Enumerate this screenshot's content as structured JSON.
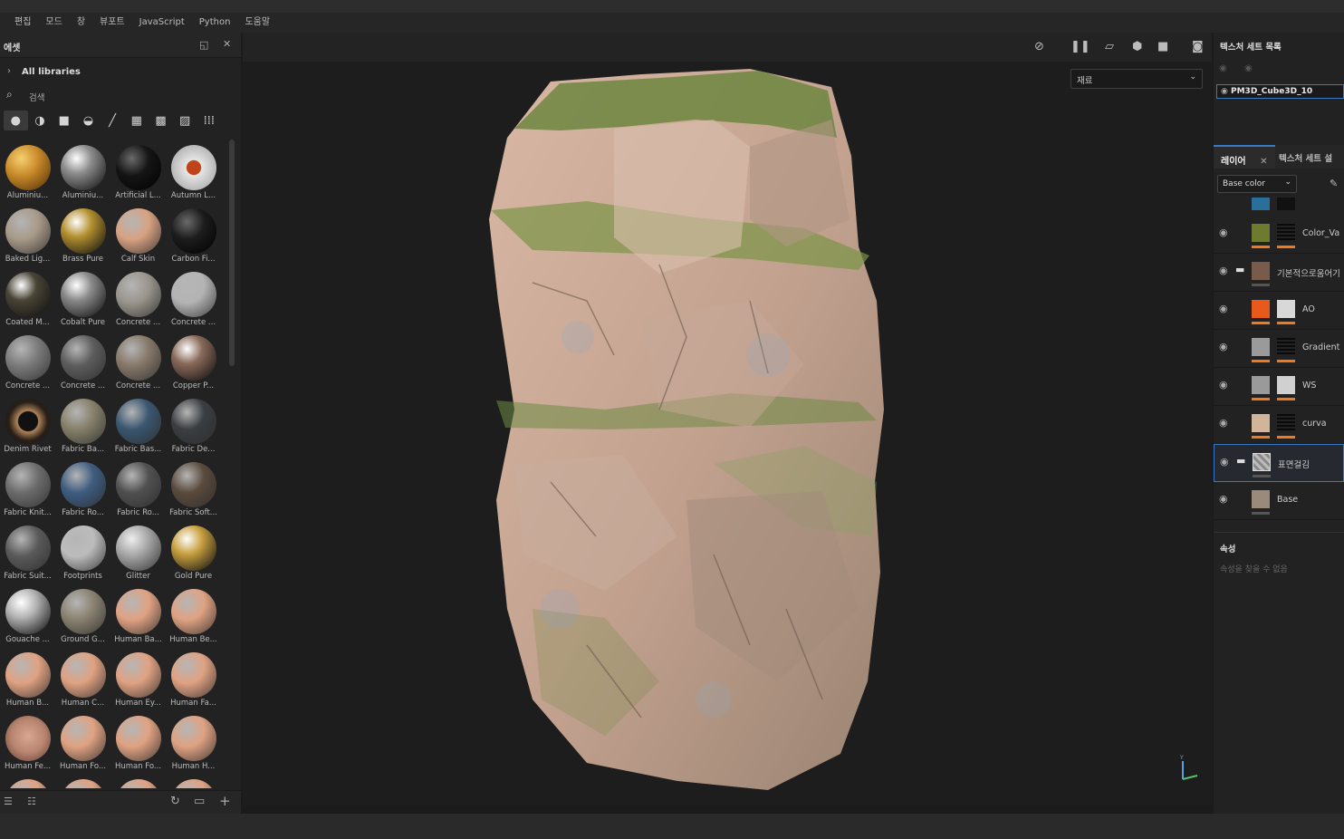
{
  "menu": [
    "편집",
    "모드",
    "창",
    "뷰포트",
    "JavaScript",
    "Python",
    "도움말"
  ],
  "assets": {
    "title": "에셋",
    "library": "All libraries",
    "search_placeholder": "검색",
    "filters": [
      "sphere-icon",
      "half-sphere-icon",
      "square-icon",
      "material-icon",
      "brush-icon",
      "particle-icon",
      "pattern-icon",
      "image-icon",
      "grid-view-icon"
    ],
    "items": [
      {
        "label": "Aluminiu...",
        "color": "#c88a2a",
        "style": "gold-dots"
      },
      {
        "label": "Aluminiu...",
        "color": "#8c8c8c",
        "style": "metal"
      },
      {
        "label": "Artificial L...",
        "color": "#151515",
        "style": "dark"
      },
      {
        "label": "Autumn L...",
        "color": "#d8d8d8",
        "style": "leaf"
      },
      {
        "label": "Baked Lig...",
        "color": "#a89a88",
        "style": "matte"
      },
      {
        "label": "Brass Pure",
        "color": "#b49030",
        "style": "metal"
      },
      {
        "label": "Calf Skin",
        "color": "#d8a282",
        "style": "matte"
      },
      {
        "label": "Carbon Fi...",
        "color": "#1c1c1c",
        "style": "carbon"
      },
      {
        "label": "Coated M...",
        "color": "#4a4436",
        "style": "metal"
      },
      {
        "label": "Cobalt Pure",
        "color": "#8a8a8a",
        "style": "metal"
      },
      {
        "label": "Concrete ...",
        "color": "#9a958c",
        "style": "matte"
      },
      {
        "label": "Concrete ...",
        "color": "#b4b4b4",
        "style": "matte"
      },
      {
        "label": "Concrete ...",
        "color": "#7a7a7a",
        "style": "matte"
      },
      {
        "label": "Concrete ...",
        "color": "#5c5c5c",
        "style": "matte"
      },
      {
        "label": "Concrete ...",
        "color": "#86786a",
        "style": "matte"
      },
      {
        "label": "Copper P...",
        "color": "#8a6a5a",
        "style": "metal"
      },
      {
        "label": "Denim Rivet",
        "color": "#3a3024",
        "style": "rivet"
      },
      {
        "label": "Fabric Ba...",
        "color": "#86806a",
        "style": "matte"
      },
      {
        "label": "Fabric Bas...",
        "color": "#3a5670",
        "style": "matte"
      },
      {
        "label": "Fabric De...",
        "color": "#3a3e42",
        "style": "matte"
      },
      {
        "label": "Fabric Knit...",
        "color": "#6c6c6c",
        "style": "matte"
      },
      {
        "label": "Fabric Ro...",
        "color": "#3e5c80",
        "style": "matte"
      },
      {
        "label": "Fabric Ro...",
        "color": "#505050",
        "style": "matte"
      },
      {
        "label": "Fabric Soft...",
        "color": "#5a4a3c",
        "style": "matte"
      },
      {
        "label": "Fabric Suit...",
        "color": "#5a5a5a",
        "style": "matte"
      },
      {
        "label": "Footprints",
        "color": "#bcbcbc",
        "style": "matte"
      },
      {
        "label": "Glitter",
        "color": "#9a9a9a",
        "style": "glitter"
      },
      {
        "label": "Gold Pure",
        "color": "#c8a040",
        "style": "metal"
      },
      {
        "label": "Gouache ...",
        "color": "#b4b4b4",
        "style": "metal"
      },
      {
        "label": "Ground G...",
        "color": "#8a8270",
        "style": "matte"
      },
      {
        "label": "Human Ba...",
        "color": "#e0a282",
        "style": "matte"
      },
      {
        "label": "Human Be...",
        "color": "#e0a282",
        "style": "matte"
      },
      {
        "label": "Human B...",
        "color": "#e0a282",
        "style": "matte"
      },
      {
        "label": "Human C...",
        "color": "#e0a282",
        "style": "matte"
      },
      {
        "label": "Human Ey...",
        "color": "#e0a282",
        "style": "matte"
      },
      {
        "label": "Human Fa...",
        "color": "#e0a282",
        "style": "matte"
      },
      {
        "label": "Human Fe...",
        "color": "#c89a84",
        "style": "face"
      },
      {
        "label": "Human Fo...",
        "color": "#e0a282",
        "style": "matte"
      },
      {
        "label": "Human Fo...",
        "color": "#e0a282",
        "style": "matte"
      },
      {
        "label": "Human H...",
        "color": "#e0a282",
        "style": "matte"
      },
      {
        "label": "",
        "color": "#e0a282",
        "style": "matte"
      },
      {
        "label": "",
        "color": "#e0a282",
        "style": "matte"
      },
      {
        "label": "",
        "color": "#e0a282",
        "style": "matte"
      },
      {
        "label": "",
        "color": "#e0a282",
        "style": "matte"
      }
    ]
  },
  "viewport": {
    "channel": "재료"
  },
  "texture_sets": {
    "title": "텍스처 세트 목록",
    "set_name": "PM3D_Cube3D_10"
  },
  "layers": {
    "tab_label": "레이어",
    "tab2_label": "텍스처 세트 설",
    "blend_mode": "Base color",
    "items": [
      {
        "name": "Color_Va",
        "swatch": "#6e7a30",
        "mask": "#111",
        "bar": "or",
        "folder": false,
        "selected": false
      },
      {
        "name": "기본적으로움어기",
        "swatch": "#7a5a4a",
        "mask": "",
        "bar": "gray",
        "folder": true,
        "selected": false
      },
      {
        "name": "AO",
        "swatch": "#e85a1c",
        "mask": "#d8d8d8",
        "bar": "or",
        "folder": false,
        "selected": false
      },
      {
        "name": "Gradient",
        "swatch": "#9a9a9a",
        "mask": "#111",
        "bar": "or",
        "folder": false,
        "selected": false
      },
      {
        "name": "WS",
        "swatch": "#9a9a9a",
        "mask": "#d0d0d0",
        "bar": "or",
        "folder": false,
        "selected": false
      },
      {
        "name": "curva",
        "swatch": "#d2b49a",
        "mask": "#111",
        "bar": "or",
        "folder": false,
        "selected": false
      },
      {
        "name": "표면걸김",
        "swatch": "#aaaaaa",
        "mask": "",
        "bar": "gray",
        "folder": true,
        "selected": true
      },
      {
        "name": "Base",
        "swatch": "#9a8a7a",
        "mask": "",
        "bar": "gray",
        "folder": false,
        "selected": false
      }
    ]
  },
  "properties": {
    "title": "속성",
    "empty_text": "속성을 찾을 수 없음"
  }
}
